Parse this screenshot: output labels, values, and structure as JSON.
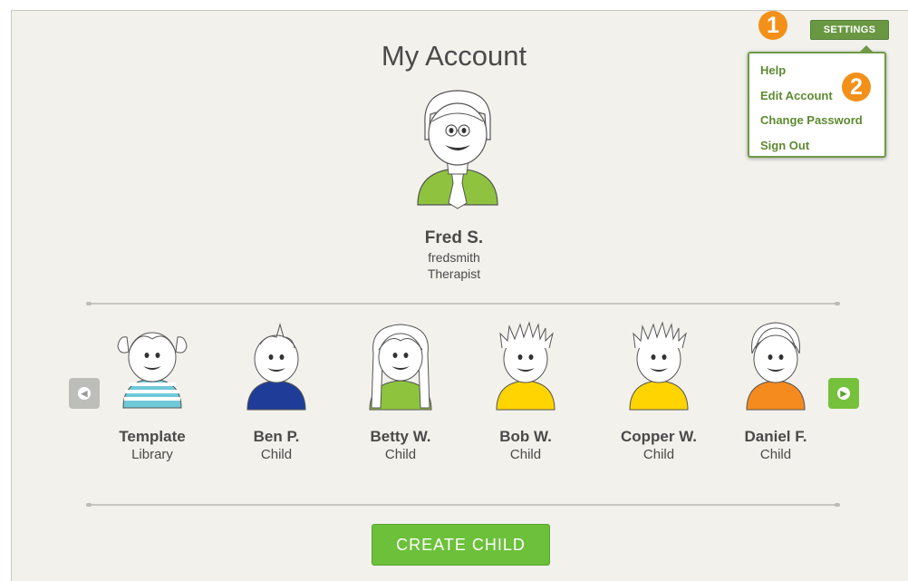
{
  "page": {
    "title": "My Account"
  },
  "user": {
    "name": "Fred S.",
    "username": "fredsmith",
    "role": "Therapist"
  },
  "children": [
    {
      "name": "Template",
      "role": "Library",
      "shirt": "#6fc9d8"
    },
    {
      "name": "Ben P.",
      "role": "Child",
      "shirt": "#1f3d98"
    },
    {
      "name": "Betty W.",
      "role": "Child",
      "shirt": "#8ec43d"
    },
    {
      "name": "Bob W.",
      "role": "Child",
      "shirt": "#ffd400"
    },
    {
      "name": "Copper W.",
      "role": "Child",
      "shirt": "#ffd400"
    },
    {
      "name": "Daniel F.",
      "role": "Child",
      "shirt": "#f58a1f"
    }
  ],
  "actions": {
    "create_child": "CREATE CHILD",
    "settings": "SETTINGS"
  },
  "settings_menu": {
    "items": [
      "Help",
      "Edit Account",
      "Change Password",
      "Sign Out"
    ]
  },
  "callouts": [
    "1",
    "2"
  ],
  "colors": {
    "accent_green": "#6cc03a",
    "settings_green": "#6a9842",
    "menu_text": "#5d8a31",
    "callout_orange": "#f39019"
  }
}
